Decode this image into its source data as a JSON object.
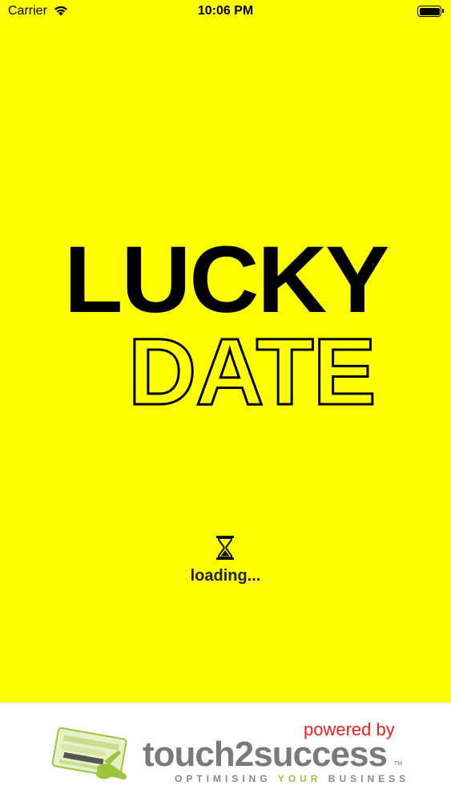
{
  "status_bar": {
    "carrier": "Carrier",
    "time": "10:06 PM",
    "wifi_icon": "wifi-icon",
    "battery_icon": "battery-icon"
  },
  "logo": {
    "line1": "LUCKY",
    "line2": "DATE"
  },
  "loading": {
    "icon": "hourglass-icon",
    "text": "loading..."
  },
  "footer": {
    "powered_by": "powered by",
    "brand": "touch2success",
    "trademark": "TM",
    "tagline_part1": "OPTIMISING ",
    "tagline_highlight": "YOUR",
    "tagline_part2": " BUSINESS",
    "logo_icon": "touch2success-hand-icon"
  },
  "colors": {
    "background": "#FFFF00",
    "powered_by": "#E8231E",
    "brand_gray": "#7a7a7a",
    "tagline_accent": "#9BC53D"
  }
}
